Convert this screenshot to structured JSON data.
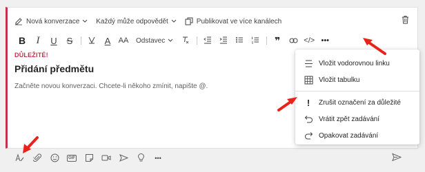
{
  "topbar": {
    "conversation_type": "Nová konverzace",
    "reply_permission": "Každý může odpovědět",
    "publish_channels": "Publikovat ve více kanálech"
  },
  "toolbar": {
    "bold": "B",
    "italic": "I",
    "underline": "U",
    "strike": "S",
    "font_color": "A",
    "font_size": "AA",
    "paragraph": "Odstavec",
    "quote": "❞",
    "code": "</>",
    "more": "•••"
  },
  "message": {
    "important_label": "DŮLEŽITÉ!",
    "subject": "Přidání předmětu",
    "placeholder": "Začněte novou konverzaci. Chcete-li někoho zmínit, napište @."
  },
  "menu": {
    "items": [
      {
        "label": "Vložit vodorovnou linku",
        "icon": "horizontal-line-icon"
      },
      {
        "label": "Vložit tabulku",
        "icon": "table-icon"
      },
      {
        "label": "Zrušit označení za důležité",
        "icon": "exclamation-icon"
      },
      {
        "label": "Vrátit zpět zadávání",
        "icon": "undo-icon"
      },
      {
        "label": "Opakovat zadávání",
        "icon": "redo-icon"
      }
    ]
  },
  "bottom": {
    "gif": "GIF",
    "more": "•••"
  },
  "colors": {
    "accent_red": "#c4314b",
    "arrow_red": "#e8231a",
    "text": "#242424"
  }
}
